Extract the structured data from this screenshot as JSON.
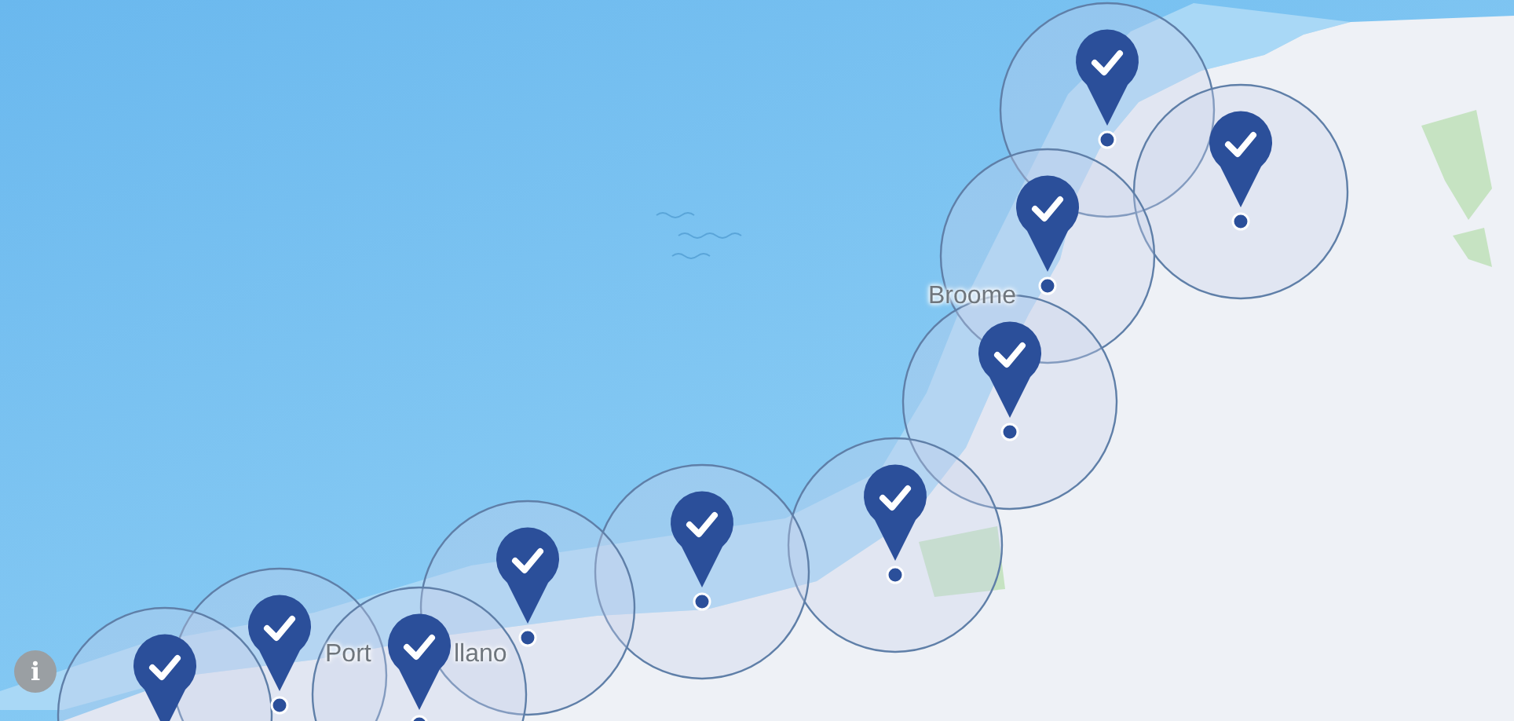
{
  "map": {
    "labels": [
      {
        "text": "Broome"
      },
      {
        "text": "Port"
      },
      {
        "text": "llano"
      }
    ],
    "pins": [
      {
        "checked": true
      },
      {
        "checked": true
      },
      {
        "checked": true
      },
      {
        "checked": true
      },
      {
        "checked": true
      },
      {
        "checked": true
      },
      {
        "checked": true
      },
      {
        "checked": true
      },
      {
        "checked": true
      },
      {
        "checked": true
      }
    ],
    "info_button": {
      "label": "i"
    }
  }
}
